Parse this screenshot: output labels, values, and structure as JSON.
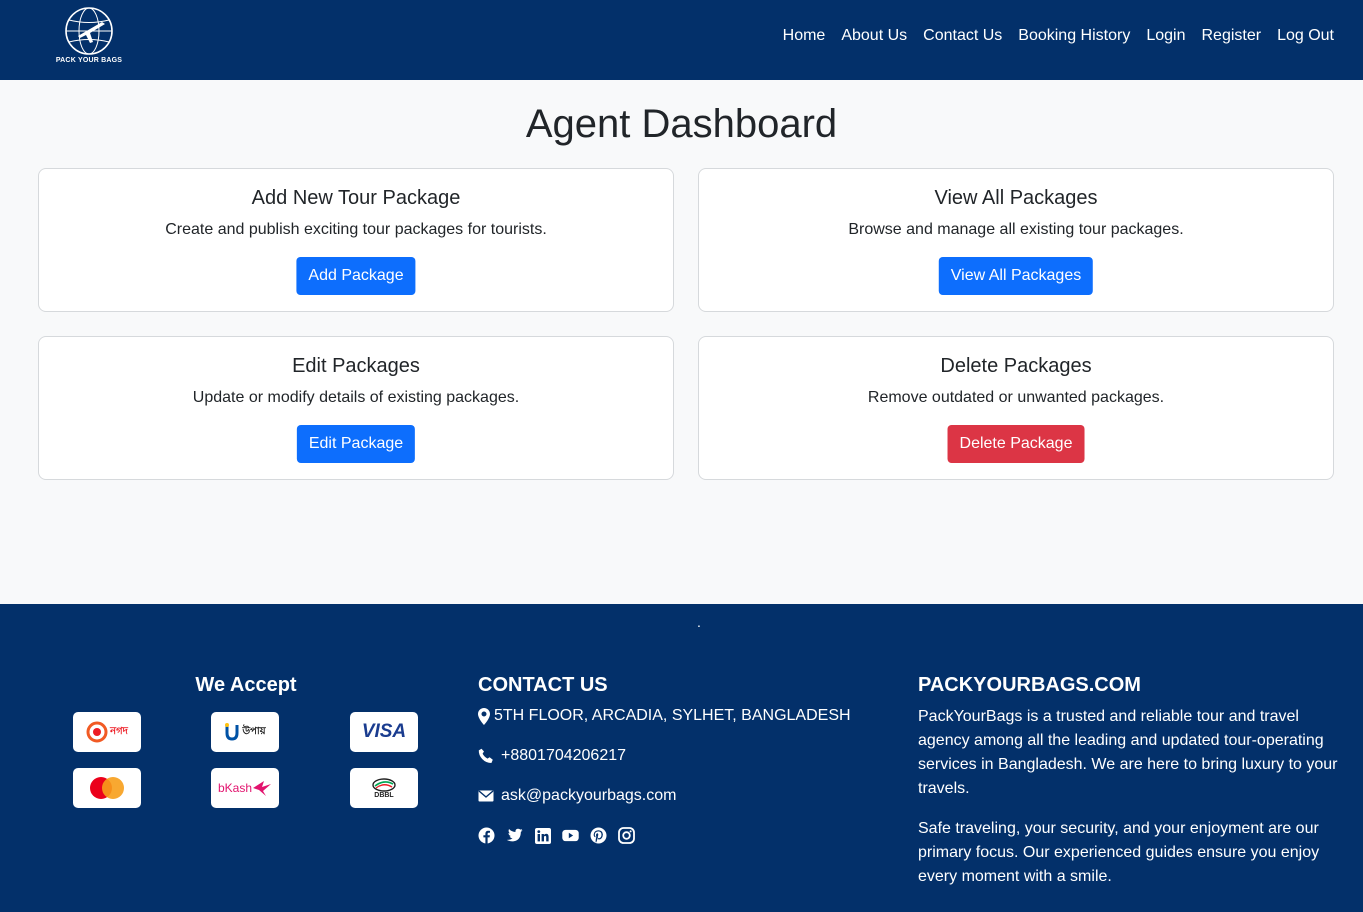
{
  "navbar": {
    "logo_text": "PACK YOUR BAGS",
    "links": [
      "Home",
      "About Us",
      "Contact Us",
      "Booking History",
      "Login",
      "Register",
      "Log Out"
    ]
  },
  "main": {
    "title": "Agent Dashboard",
    "cards": [
      {
        "title": "Add New Tour Package",
        "text": "Create and publish exciting tour packages for tourists.",
        "button": "Add Package",
        "button_color": "#0d6efd"
      },
      {
        "title": "View All Packages",
        "text": "Browse and manage all existing tour packages.",
        "button": "View All Packages",
        "button_color": "#0d6efd"
      },
      {
        "title": "Edit Packages",
        "text": "Update or modify details of existing packages.",
        "button": "Edit Package",
        "button_color": "#0d6efd"
      },
      {
        "title": "Delete Packages",
        "text": "Remove outdated or unwanted packages.",
        "button": "Delete Package",
        "button_color": "#dc3545"
      }
    ]
  },
  "footer": {
    "dot": ".",
    "accept_title": "We Accept",
    "payment_logos": [
      "nagad-logo",
      "upay-logo",
      "visa-logo",
      "mastercard-logo",
      "bkash-logo",
      "dbbl-logo"
    ],
    "payment_labels": {
      "nagad": "নগদ",
      "upay": "উপায়",
      "visa": "VISA",
      "bkash": "bKash",
      "dbbl": "DBBL"
    },
    "contact_title": "CONTACT US",
    "address": "5TH FLOOR, ARCADIA, SYLHET, BANGLADESH",
    "phone": "+8801704206217",
    "email": "ask@packyourbags.com",
    "socials": [
      "facebook-icon",
      "twitter-icon",
      "linkedin-icon",
      "youtube-icon",
      "pinterest-icon",
      "instagram-icon"
    ],
    "brand_title": "PACKYOURBAGS.COM",
    "brand_p1": "PackYourBags is a trusted and reliable tour and travel agency among all the leading and updated tour-operating services in Bangladesh. We are here to bring luxury to your travels.",
    "brand_p2": "Safe traveling, your security, and your enjoyment are our primary focus. Our experienced guides ensure you enjoy every moment with a smile."
  },
  "colors": {
    "navy": "#03306a",
    "primary": "#0d6efd",
    "danger": "#dc3545"
  }
}
